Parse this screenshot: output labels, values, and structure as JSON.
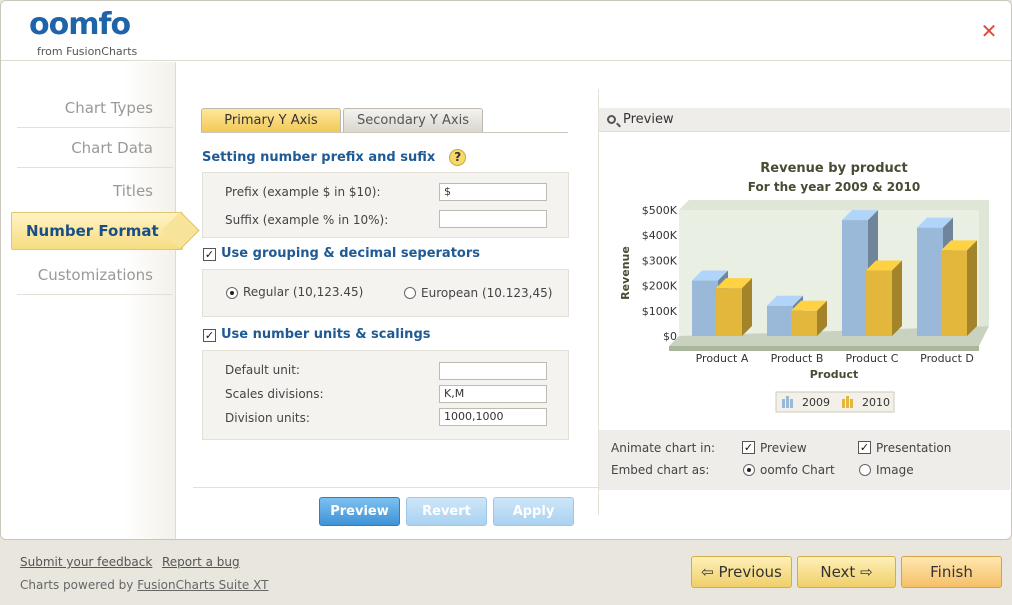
{
  "logo": {
    "brand": "oomfo",
    "sub": "from FusionCharts"
  },
  "nav": [
    {
      "label": "Chart Types"
    },
    {
      "label": "Chart Data"
    },
    {
      "label": "Titles"
    },
    {
      "label": "Number Format",
      "active": true
    },
    {
      "label": "Customizations"
    }
  ],
  "tabs": {
    "primary": "Primary Y Axis",
    "secondary": "Secondary Y Axis"
  },
  "prefix_section": {
    "title": "Setting number prefix and sufix",
    "help": "?",
    "prefix_label": "Prefix (example $ in $10):",
    "prefix_value": "$",
    "suffix_label": "Suffix (example % in 10%):",
    "suffix_value": ""
  },
  "grouping_section": {
    "title": "Use grouping & decimal seperators",
    "checked": true,
    "regular_label": "Regular (10,123.45)",
    "european_label": "European (10.123,45)",
    "selected": "regular"
  },
  "units_section": {
    "title": "Use number units & scalings",
    "checked": true,
    "default_unit_label": "Default unit:",
    "default_unit_value": "",
    "scales_label": "Scales divisions:",
    "scales_value": "K,M",
    "division_label": "Division units:",
    "division_value": "1000,1000"
  },
  "buttons": {
    "preview": "Preview",
    "revert": "Revert",
    "apply": "Apply"
  },
  "preview_panel": {
    "header": "Preview",
    "animate_label": "Animate chart in:",
    "animate_preview": "Preview",
    "animate_presentation": "Presentation",
    "embed_label": "Embed chart as:",
    "embed_oomfo": "oomfo Chart",
    "embed_image": "Image"
  },
  "chart_data": {
    "type": "bar",
    "title": "Revenue by product",
    "subtitle": "For the year 2009 & 2010",
    "xlabel": "Product",
    "ylabel": "Revenue",
    "categories": [
      "Product A",
      "Product B",
      "Product C",
      "Product D"
    ],
    "y_ticks": [
      "$0",
      "$100K",
      "$200K",
      "$300K",
      "$400K",
      "$500K"
    ],
    "ylim": [
      0,
      500000
    ],
    "series": [
      {
        "name": "2009",
        "values": [
          220000,
          120000,
          460000,
          430000
        ],
        "color": "#9ab9d9"
      },
      {
        "name": "2010",
        "values": [
          190000,
          100000,
          260000,
          340000
        ],
        "color": "#e2b73b"
      }
    ],
    "legend": "bottom"
  },
  "footer": {
    "feedback": "Submit your feedback",
    "bug": "Report a bug",
    "powered_prefix": "Charts powered by ",
    "powered_link": "FusionCharts Suite XT",
    "previous": "Previous",
    "next": "Next",
    "finish": "Finish"
  },
  "colors": {
    "accent": "#1f5a95",
    "tab_active": "#f1c955",
    "button_blue": "#3f93d6"
  }
}
